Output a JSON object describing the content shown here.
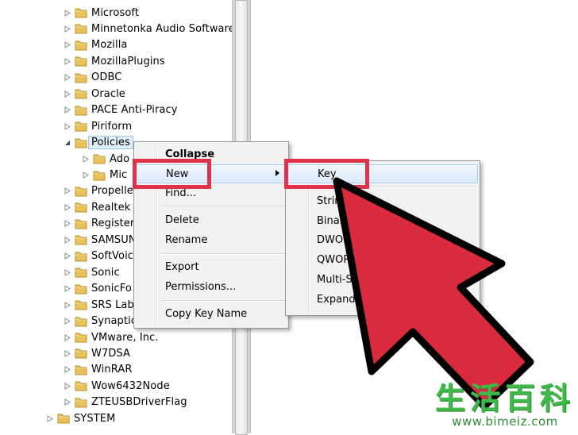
{
  "tree": {
    "items": [
      {
        "label": "Microsoft"
      },
      {
        "label": "Minnetonka Audio Software"
      },
      {
        "label": "Mozilla"
      },
      {
        "label": "MozillaPlugins"
      },
      {
        "label": "ODBC"
      },
      {
        "label": "Oracle"
      },
      {
        "label": "PACE Anti-Piracy"
      },
      {
        "label": "Piriform"
      },
      {
        "label": "Policies"
      },
      {
        "label": "Ado"
      },
      {
        "label": "Mic"
      },
      {
        "label": "Propelle"
      },
      {
        "label": "Realtek"
      },
      {
        "label": "Register"
      },
      {
        "label": "SAMSUN"
      },
      {
        "label": "SoftVoic"
      },
      {
        "label": "Sonic"
      },
      {
        "label": "SonicFo"
      },
      {
        "label": "SRS Lab"
      },
      {
        "label": "Synaptic"
      },
      {
        "label": "VMware, Inc."
      },
      {
        "label": "W7DSA"
      },
      {
        "label": "WinRAR"
      },
      {
        "label": "Wow6432Node"
      },
      {
        "label": "ZTEUSBDriverFlag"
      },
      {
        "label": "SYSTEM"
      }
    ]
  },
  "context_menu": {
    "items": {
      "collapse": "Collapse",
      "new": "New",
      "find": "Find...",
      "delete": "Delete",
      "rename": "Rename",
      "export": "Export",
      "permissions": "Permissions...",
      "copy_key_name": "Copy Key Name"
    }
  },
  "new_submenu": {
    "items": {
      "key": "Key",
      "string": "Strin",
      "binary": "Binar",
      "dword": "DWOR",
      "qword": "QWOR",
      "multi_string": "Multi-St",
      "expandable": "Expandab"
    }
  },
  "colors": {
    "highlight": "#e0334a",
    "arrow_fill": "#d92a3e",
    "folder": "#e8c25a"
  },
  "watermark": {
    "chinese": "生活百科",
    "url": "www.bimeiz.com"
  }
}
